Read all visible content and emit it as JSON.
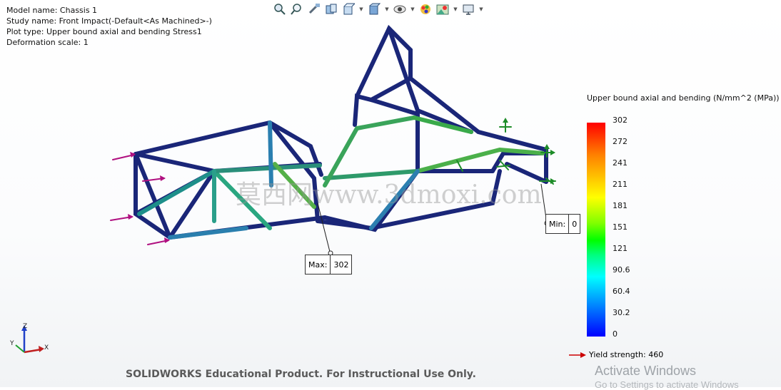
{
  "info": {
    "model_name": "Model name: Chassis 1",
    "study_name": "Study name: Front Impact(-Default<As Machined>-)",
    "plot_type": "Plot type: Upper bound axial and bending Stress1",
    "deformation_scale": "Deformation scale: 1"
  },
  "toolbar": {
    "icons": [
      "zoom-to-fit-icon",
      "zoom-area-icon",
      "previous-view-icon",
      "section-view-icon",
      "view-orientation-icon",
      "display-style-icon",
      "hide-show-icon",
      "edit-appearance-icon",
      "apply-scene-icon",
      "view-settings-icon"
    ]
  },
  "callouts": {
    "max_label": "Max:",
    "max_value": "302",
    "min_label": "Min:",
    "min_value": "0"
  },
  "legend": {
    "title": "Upper bound axial and bending (N/mm^2 (MPa))",
    "ticks": [
      "302",
      "272",
      "241",
      "211",
      "181",
      "151",
      "121",
      "90.6",
      "60.4",
      "30.2",
      "0"
    ],
    "colors": [
      "#ff0000",
      "#ff8000",
      "#ffff00",
      "#00ff00",
      "#00ffff",
      "#0000ff"
    ],
    "yield_text": "Yield strength: 460",
    "yield_arrow_color": "#cc0000"
  },
  "triad": {
    "x": "X",
    "y": "Y",
    "z": "Z"
  },
  "watermarks": {
    "edu": "SOLIDWORKS Educational Product. For Instructional Use Only.",
    "activate_title": "Activate Windows",
    "activate_sub": "Go to Settings to activate Windows",
    "site": "莫西网www.3dmoxi.com"
  }
}
